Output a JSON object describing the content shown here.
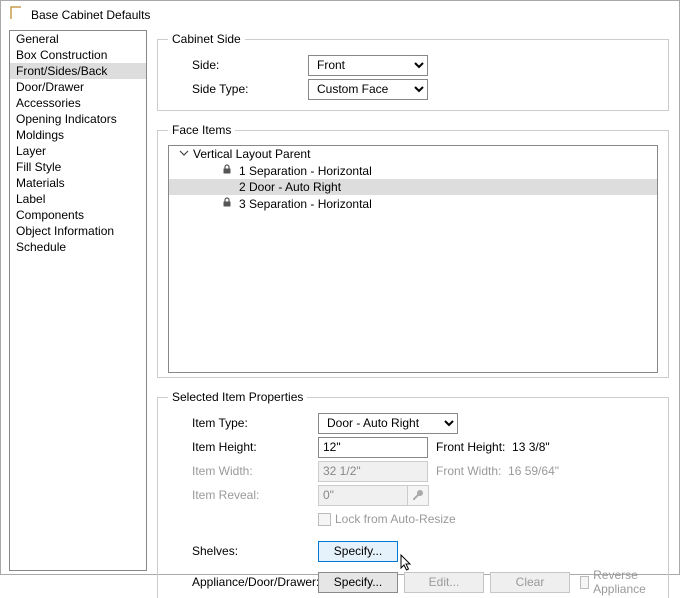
{
  "window": {
    "title": "Base Cabinet Defaults"
  },
  "sidebar": {
    "items": [
      {
        "label": "General"
      },
      {
        "label": "Box Construction"
      },
      {
        "label": "Front/Sides/Back",
        "selected": true
      },
      {
        "label": "Door/Drawer"
      },
      {
        "label": "Accessories"
      },
      {
        "label": "Opening Indicators"
      },
      {
        "label": "Moldings"
      },
      {
        "label": "Layer"
      },
      {
        "label": "Fill Style"
      },
      {
        "label": "Materials"
      },
      {
        "label": "Label"
      },
      {
        "label": "Components"
      },
      {
        "label": "Object Information"
      },
      {
        "label": "Schedule"
      }
    ]
  },
  "cabinetSide": {
    "legend": "Cabinet Side",
    "sideLabel": "Side:",
    "sideValue": "Front",
    "sideTypeLabel": "Side Type:",
    "sideTypeValue": "Custom Face"
  },
  "faceItems": {
    "legend": "Face Items",
    "root": "Vertical Layout Parent",
    "items": [
      {
        "label": "1 Separation - Horizontal",
        "locked": true
      },
      {
        "label": "2 Door - Auto Right",
        "locked": false,
        "selected": true
      },
      {
        "label": "3 Separation - Horizontal",
        "locked": true
      }
    ]
  },
  "props": {
    "legend": "Selected Item Properties",
    "itemTypeLabel": "Item Type:",
    "itemTypeValue": "Door - Auto Right",
    "itemHeightLabel": "Item Height:",
    "itemHeightValue": "12\"",
    "frontHeightLabel": "Front Height:",
    "frontHeightValue": "13 3/8\"",
    "itemWidthLabel": "Item Width:",
    "itemWidthValue": "32 1/2\"",
    "frontWidthLabel": "Front Width:",
    "frontWidthValue": "16 59/64\"",
    "itemRevealLabel": "Item Reveal:",
    "itemRevealValue": "0\"",
    "lockLabel": "Lock from Auto-Resize",
    "shelvesLabel": "Shelves:",
    "specify": "Specify...",
    "applianceLabel": "Appliance/Door/Drawer:",
    "edit": "Edit...",
    "clear": "Clear",
    "reverse": "Reverse Appliance"
  }
}
